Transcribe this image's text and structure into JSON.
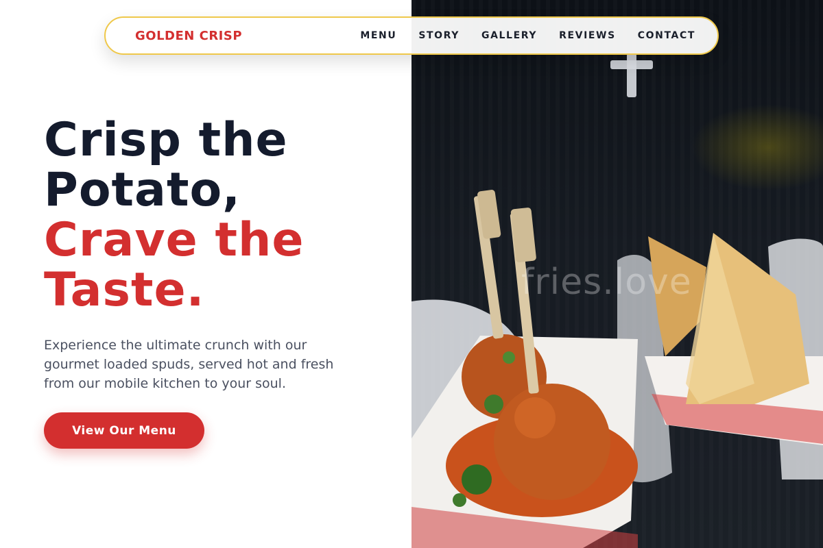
{
  "brand": {
    "name": "GOLDEN CRISP"
  },
  "nav": {
    "items": [
      {
        "label": "MENU"
      },
      {
        "label": "STORY"
      },
      {
        "label": "GALLERY"
      },
      {
        "label": "REVIEWS"
      },
      {
        "label": "CONTACT"
      }
    ]
  },
  "hero": {
    "title_line1": "Crisp the",
    "title_line2": "Potato,",
    "title_line3": "Crave the",
    "title_line4": "Taste.",
    "description": "Experience the ultimate crunch with our gourmet loaded spuds, served hot and fresh from our mobile kitchen to your soul.",
    "cta_label": "View Our Menu"
  },
  "photo": {
    "watermark": "fries.love"
  },
  "colors": {
    "accent": "#d32f2f",
    "heading": "#141b2d",
    "nav_border": "#efc84a"
  }
}
